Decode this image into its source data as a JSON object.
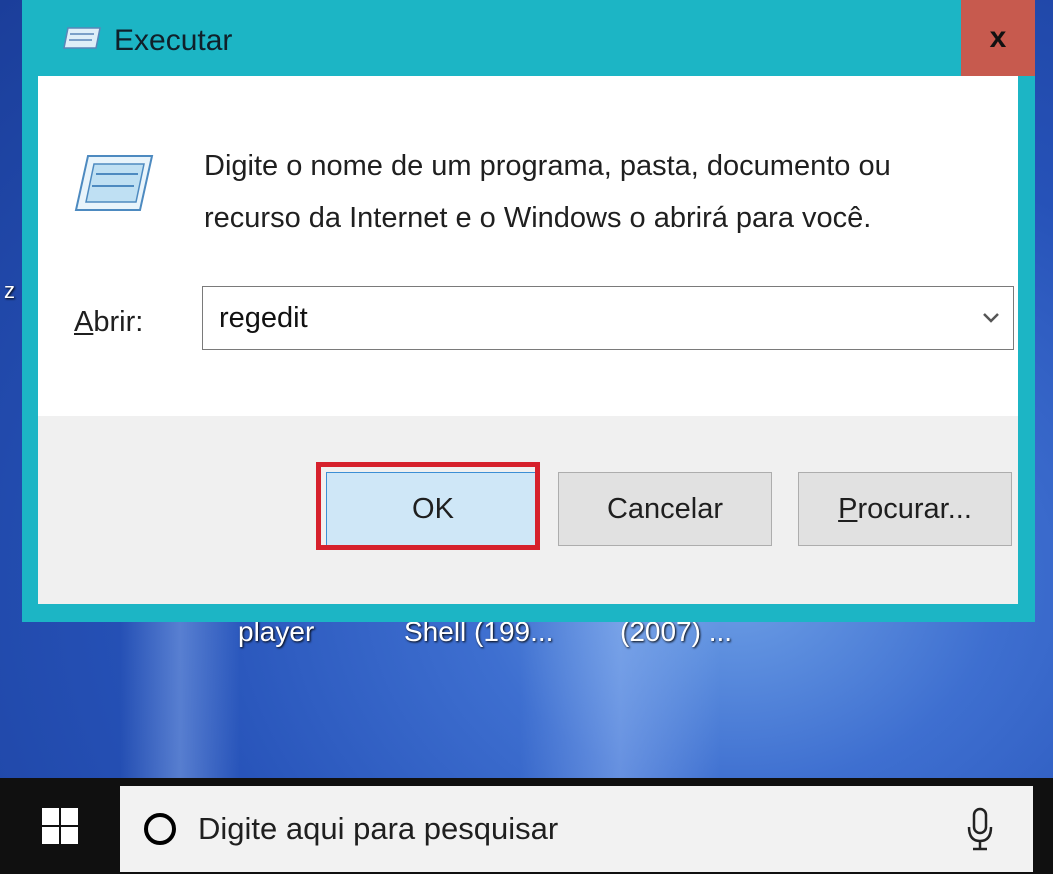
{
  "dialog": {
    "title": "Executar",
    "close_label": "x",
    "description": "Digite o nome de um programa, pasta, documento ou recurso da Internet e o Windows o abrirá para você.",
    "open_label_accesskey": "A",
    "open_label_rest": "brir:",
    "open_value": "regedit",
    "ok_label": "OK",
    "cancel_label": "Cancelar",
    "browse_accesskey": "P",
    "browse_rest": "rocurar..."
  },
  "desktop": {
    "left_char": "z",
    "labels": [
      "player",
      "Shell (199...",
      "(2007) ..."
    ]
  },
  "taskbar": {
    "search_placeholder": "Digite aqui para pesquisar"
  },
  "icons": {
    "title": "run-icon",
    "content": "run-icon",
    "start": "windows-logo-icon",
    "search": "cortana-icon",
    "mic": "microphone-icon",
    "combo": "chevron-down-icon"
  },
  "colors": {
    "dialog_frame": "#1cb5c5",
    "close_button": "#c75a4e",
    "ok_highlight": "#d6212c"
  }
}
